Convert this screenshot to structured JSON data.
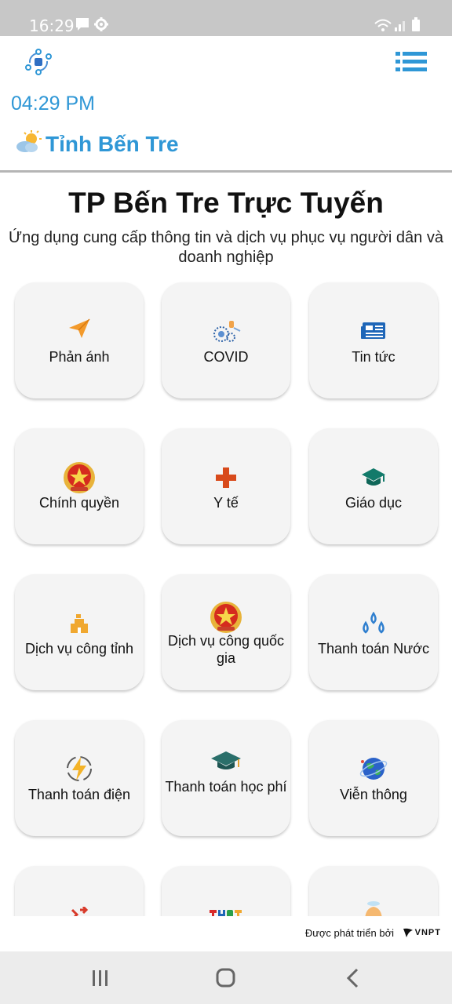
{
  "status_bar": {
    "time": "16:29",
    "icons": [
      "message-icon",
      "settings-gear-icon",
      "wifi-icon",
      "signal-icon",
      "battery-icon"
    ]
  },
  "header": {
    "logo_icon": "app-logo-icon",
    "menu_icon": "list-menu-icon",
    "clock": "04:29 PM",
    "weather_icon": "partly-cloudy-icon",
    "location": "Tỉnh Bến Tre"
  },
  "main": {
    "title": "TP Bến Tre Trực Tuyến",
    "subtitle": "Ứng dụng cung cấp thông tin và dịch vụ phục vụ người dân và doanh nghiệp",
    "tiles": [
      {
        "label": "Phản ánh",
        "icon": "paper-plane-icon"
      },
      {
        "label": "COVID",
        "icon": "virus-icon"
      },
      {
        "label": "Tin tức",
        "icon": "newspaper-icon"
      },
      {
        "label": "Chính quyền",
        "icon": "national-emblem-icon"
      },
      {
        "label": "Y tế",
        "icon": "medical-cross-icon"
      },
      {
        "label": "Giáo dục",
        "icon": "graduation-cap-icon"
      },
      {
        "label": "Dịch vụ công tỉnh",
        "icon": "provincial-building-icon"
      },
      {
        "label": "Dịch vụ công quốc gia",
        "icon": "national-emblem-icon"
      },
      {
        "label": "Thanh toán Nước",
        "icon": "water-drops-icon"
      },
      {
        "label": "Thanh toán điện",
        "icon": "lightning-icon"
      },
      {
        "label": "Thanh toán học phí",
        "icon": "graduation-cap-icon"
      },
      {
        "label": "Viễn thông",
        "icon": "globe-icon"
      },
      {
        "label": "",
        "icon": "transport-icon"
      },
      {
        "label": "",
        "icon": "thbt-logo-icon"
      },
      {
        "label": "",
        "icon": "bell-icon"
      }
    ]
  },
  "footer": {
    "developed_by": "Được phát triển bởi",
    "brand": "VNPT"
  },
  "nav_bar": {
    "icons": [
      "recent-apps-icon",
      "home-icon",
      "back-icon"
    ]
  },
  "colors": {
    "accent": "#2f97d6",
    "tile_background": "#f4f4f4",
    "status_bar": "#c7c7c7",
    "orange": "#f39a2b",
    "red": "#d84a1b"
  }
}
